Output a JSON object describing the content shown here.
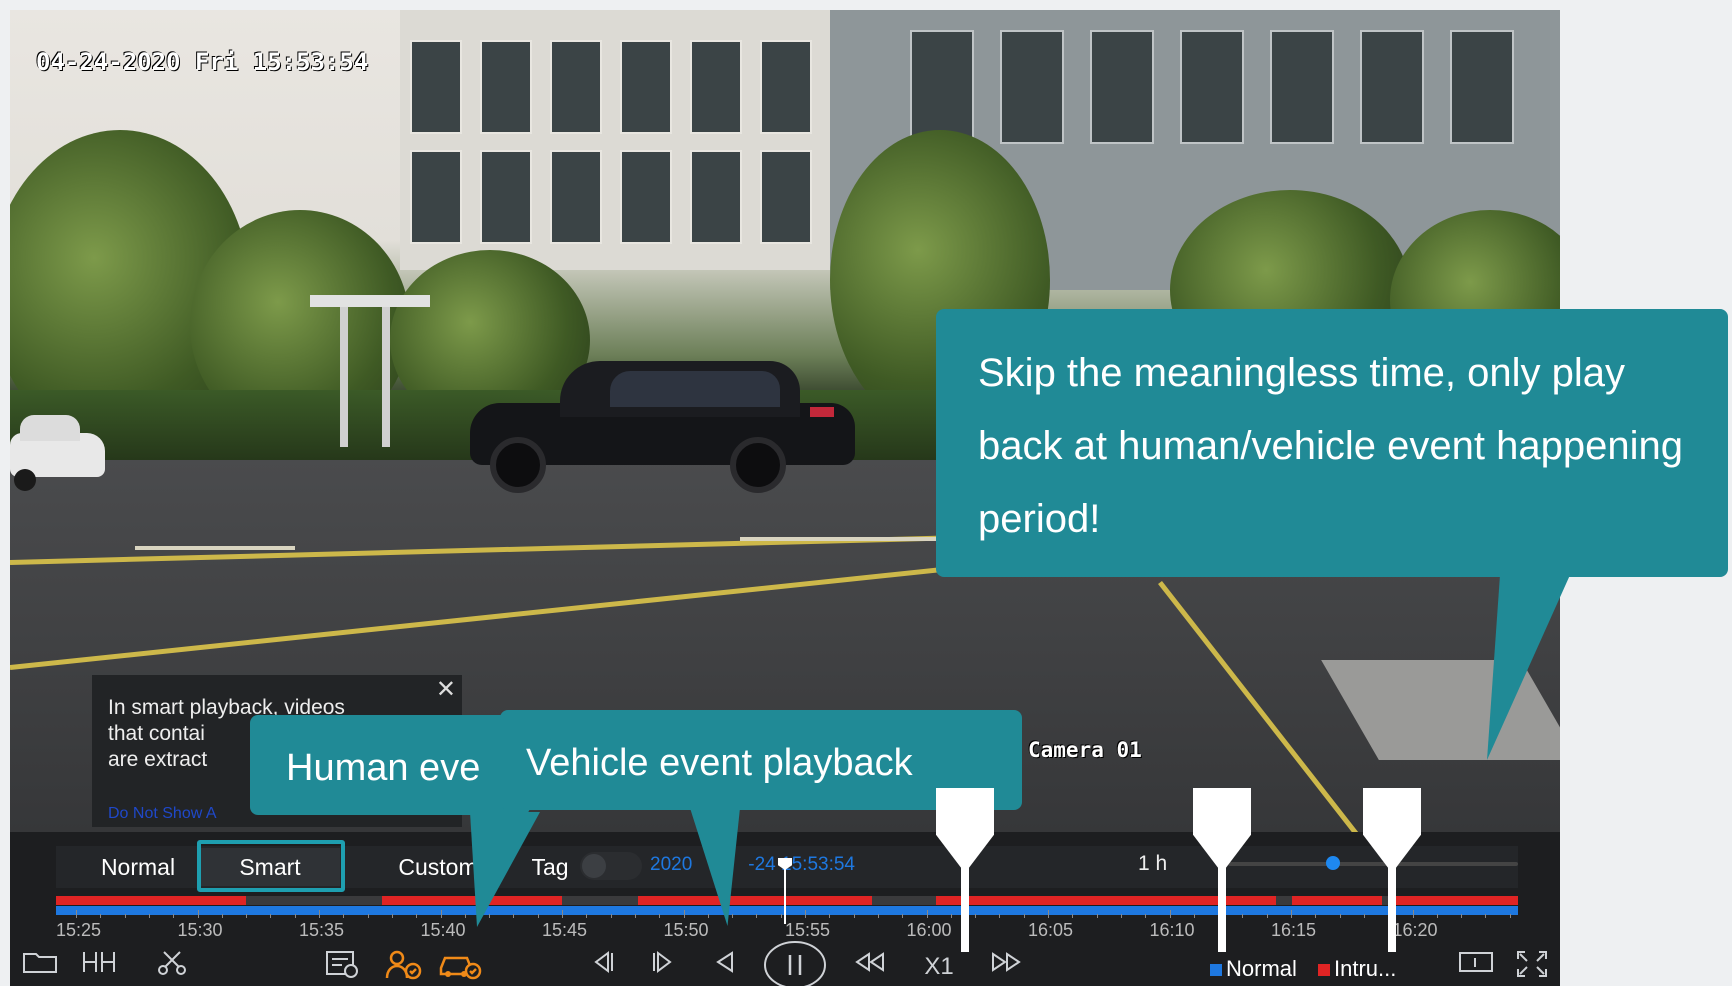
{
  "osd": {
    "datetime": "04-24-2020 Fri 15:53:54",
    "camera": "Camera 01"
  },
  "notice": {
    "text_line1": "In smart playback, videos",
    "text_line2": "that contai",
    "text_line3": "are extract",
    "do_not_show": "Do Not Show A",
    "close_icon": "close-icon"
  },
  "modes": {
    "normal": "Normal",
    "smart": "Smart",
    "custom": "Custom",
    "tag": "Tag"
  },
  "timeline": {
    "current": "2020-04-24 15:53:54",
    "current_partial_left": "2020",
    "current_partial_right": "-24",
    "current_time": "15:53:54",
    "span": "1 h",
    "ticks": [
      "15:25",
      "15:30",
      "15:35",
      "15:40",
      "15:45",
      "15:50",
      "15:55",
      "16:00",
      "16:05",
      "16:10",
      "16:15",
      "16:20"
    ]
  },
  "toolbar": {
    "icons": [
      "folder-icon",
      "clip-marker-icon",
      "scissors-icon",
      "export-list-icon",
      "human-filter-icon",
      "vehicle-filter-icon",
      "step-back-icon",
      "step-forward-icon",
      "reverse-play-icon",
      "pause-icon",
      "rewind-icon",
      "fast-forward-icon",
      "single-view-icon",
      "fullscreen-icon"
    ],
    "speed": "X1"
  },
  "legend": {
    "normal": "Normal",
    "intrusion": "Intru...",
    "normal_color": "#1e78e0",
    "intrusion_color": "#e02424"
  },
  "callouts": {
    "skip": {
      "line1": "Skip the meaningless time, only play",
      "line2": "back at human/vehicle event happening",
      "line3": "period!"
    },
    "human": "Human eve",
    "vehicle": "Vehicle event playback"
  },
  "colors": {
    "accent": "#208a96",
    "normal_track": "#1e78e0",
    "event_track": "#e02424",
    "smart_highlight": "#1e9fb0"
  }
}
